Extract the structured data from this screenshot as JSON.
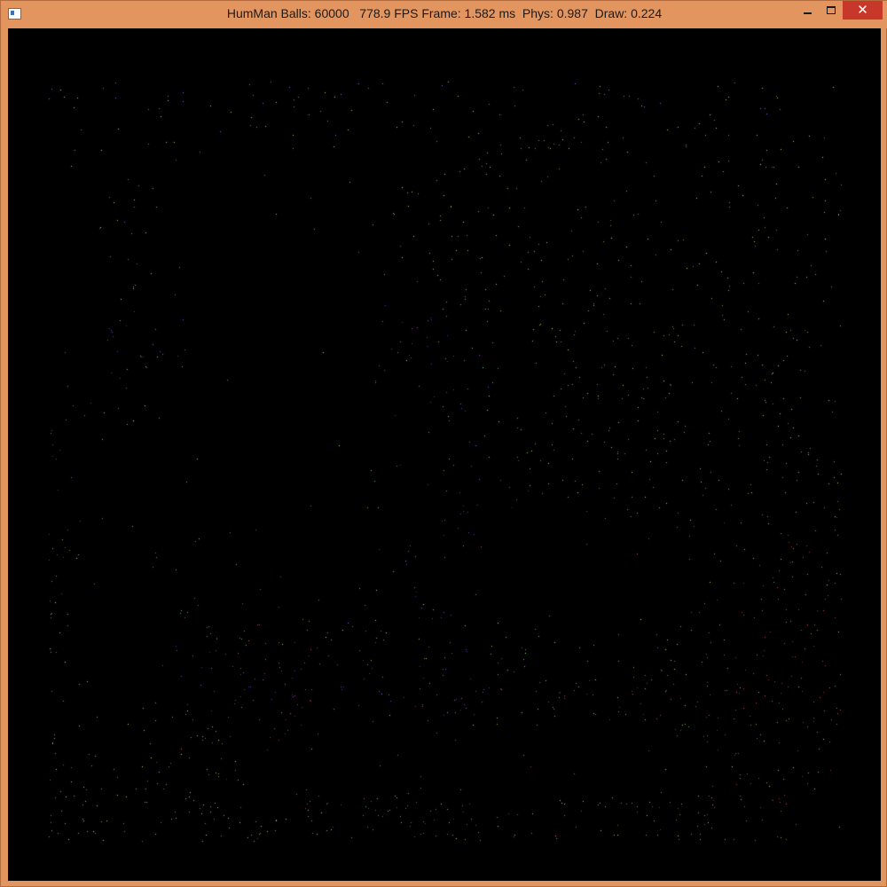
{
  "window": {
    "title": "HumMan Balls: 60000   778.9 FPS Frame: 1.582 ms  Phys: 0.987  Draw: 0.224",
    "icon": "app-window-icon",
    "controls": {
      "minimize_icon": "minimize-icon",
      "maximize_icon": "maximize-icon",
      "close_icon": "close-icon",
      "close_glyph": "✕"
    }
  },
  "colors": {
    "title_bar": "#e3955f",
    "close_button": "#c7382b",
    "canvas_background": "#000000",
    "particle_green": "#9ccc5a",
    "particle_red": "#b8405a",
    "particle_blue": "#6a4fd0"
  }
}
